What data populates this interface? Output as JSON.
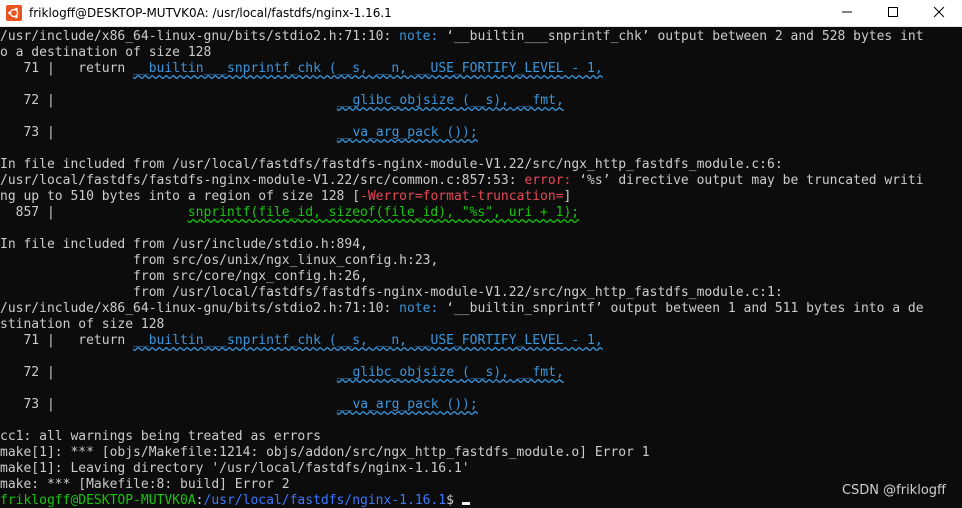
{
  "window": {
    "title": "friklogff@DESKTOP-MUTVK0A: /usr/local/fastdfs/nginx-1.16.1"
  },
  "terminal": {
    "l1_path": "/usr/include/x86_64-linux-gnu/bits/stdio2.h:71:10: ",
    "l1_note": "note:",
    "l1_msg": " ‘__builtin___snprintf_chk’ output between 2 and 528 bytes int",
    "l2": "o a destination of size 128",
    "l3_num": "   71 |   ",
    "l3_kw": "return",
    "l3_code": "__builtin___snprintf_chk (__s, __n, __USE_FORTIFY_LEVEL - 1,",
    "l4_num": "   72 |",
    "l4_code": "__glibc_objsize (__s), __fmt,",
    "l5_num": "   73 |",
    "l5_code": "__va_arg_pack ());",
    "l6": "In file included from /usr/local/fastdfs/fastdfs-nginx-module-V1.22/src/ngx_http_fastdfs_module.c:6:",
    "l7_path": "/usr/local/fastdfs/fastdfs-nginx-module-V1.22/src/common.c:857:53: ",
    "l7_err": "error:",
    "l7_msg": " ‘%s’ directive output may be truncated writi",
    "l8_msg": "ng up to 510 bytes into a region of size 128 [",
    "l8_flag": "-Werror=format-truncation=",
    "l8_end": "]",
    "l9_num": "  857 |",
    "l9_code": "snprintf(file_id, sizeof(file_id), \"%s\", uri + 1);",
    "l10": "In file included from /usr/include/stdio.h:894,",
    "l11": "                 from src/os/unix/ngx_linux_config.h:23,",
    "l12": "                 from src/core/ngx_config.h:26,",
    "l13": "                 from /usr/local/fastdfs/fastdfs-nginx-module-V1.22/src/ngx_http_fastdfs_module.c:1:",
    "l14_path": "/usr/include/x86_64-linux-gnu/bits/stdio2.h:71:10: ",
    "l14_note": "note:",
    "l14_msg": " ‘__builtin_snprintf’ output between 1 and 511 bytes into a de",
    "l15": "stination of size 128",
    "l16_num": "   71 |   ",
    "l16_kw": "return",
    "l16_code": "__builtin___snprintf_chk (__s, __n, __USE_FORTIFY_LEVEL - 1,",
    "l17_num": "   72 |",
    "l17_code": "__glibc_objsize (__s), __fmt,",
    "l18_num": "   73 |",
    "l18_code": "__va_arg_pack ());",
    "l19": "cc1: all warnings being treated as errors",
    "l20": "make[1]: *** [objs/Makefile:1214: objs/addon/src/ngx_http_fastdfs_module.o] Error 1",
    "l21": "make[1]: Leaving directory '/usr/local/fastdfs/nginx-1.16.1'",
    "l22": "make: *** [Makefile:8: build] Error 2",
    "prompt_user": "friklogff@DESKTOP-MUTVK0A",
    "prompt_sep": ":",
    "prompt_path": "/usr/local/fastdfs/nginx-1.16.1",
    "prompt_dollar": "$ "
  },
  "watermark": "CSDN @friklogff",
  "colors": {
    "background": "#0c0c0c",
    "text": "#cccccc",
    "note": "#3a96dd",
    "error": "#e74856",
    "green": "#16c60c",
    "path": "#3b78ff"
  },
  "icons": {
    "app": "ubuntu-icon",
    "minimize": "minimize-icon",
    "maximize": "maximize-icon",
    "close": "close-icon"
  }
}
